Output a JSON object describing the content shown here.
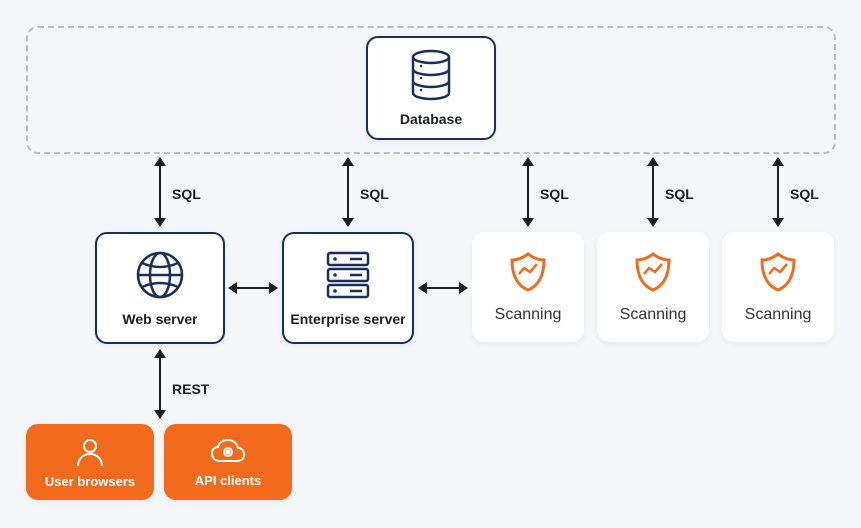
{
  "database": {
    "label": "Database"
  },
  "web_server": {
    "label": "Web server"
  },
  "enterprise_server": {
    "label": "Enterprise server"
  },
  "scanning": {
    "label": "Scanning"
  },
  "user_browsers": {
    "label": "User browsers"
  },
  "api_clients": {
    "label": "API clients"
  },
  "connectors": {
    "sql": "SQL",
    "rest": "REST"
  },
  "colors": {
    "navy": "#1a2e5a",
    "orange": "#f26a1b",
    "dash": "#b9bfc7",
    "bg": "#f4f6f9"
  }
}
